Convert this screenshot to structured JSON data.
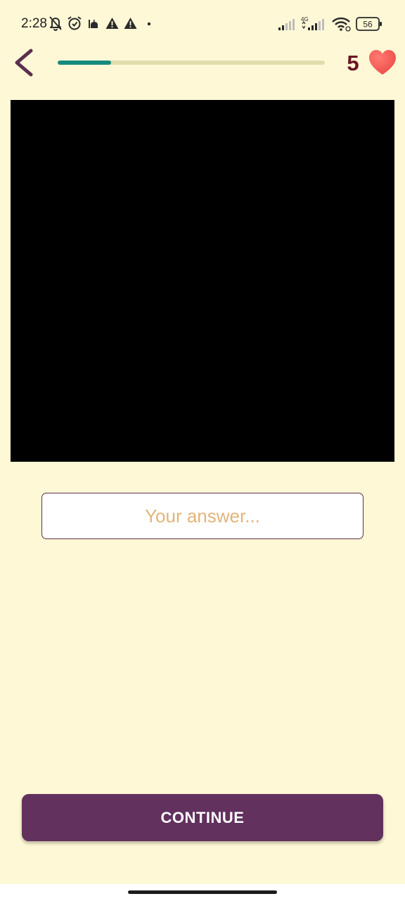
{
  "status_bar": {
    "time": "2:28",
    "battery": "56",
    "network": "4G",
    "icons": [
      "bell-off-icon",
      "alarm-icon",
      "mosque-icon",
      "warning-icon",
      "warning-icon",
      "dot-icon",
      "signal-icon",
      "signal-4g-icon",
      "wifi-icon",
      "battery-icon"
    ]
  },
  "header": {
    "back_icon": "chevron-left-icon",
    "progress_fraction": 0.2,
    "progress_color": "#168a7e",
    "track_color": "#e3dcaf",
    "lives": "5",
    "lives_icon": "heart-icon",
    "heart_color": "#f2544f"
  },
  "media": {
    "background": "#000000"
  },
  "answer": {
    "placeholder": "Your answer...",
    "value": ""
  },
  "footer": {
    "continue_label": "CONTINUE",
    "button_color": "#62315e"
  },
  "theme": {
    "background": "#fef8d6",
    "accent": "#6a1523"
  }
}
